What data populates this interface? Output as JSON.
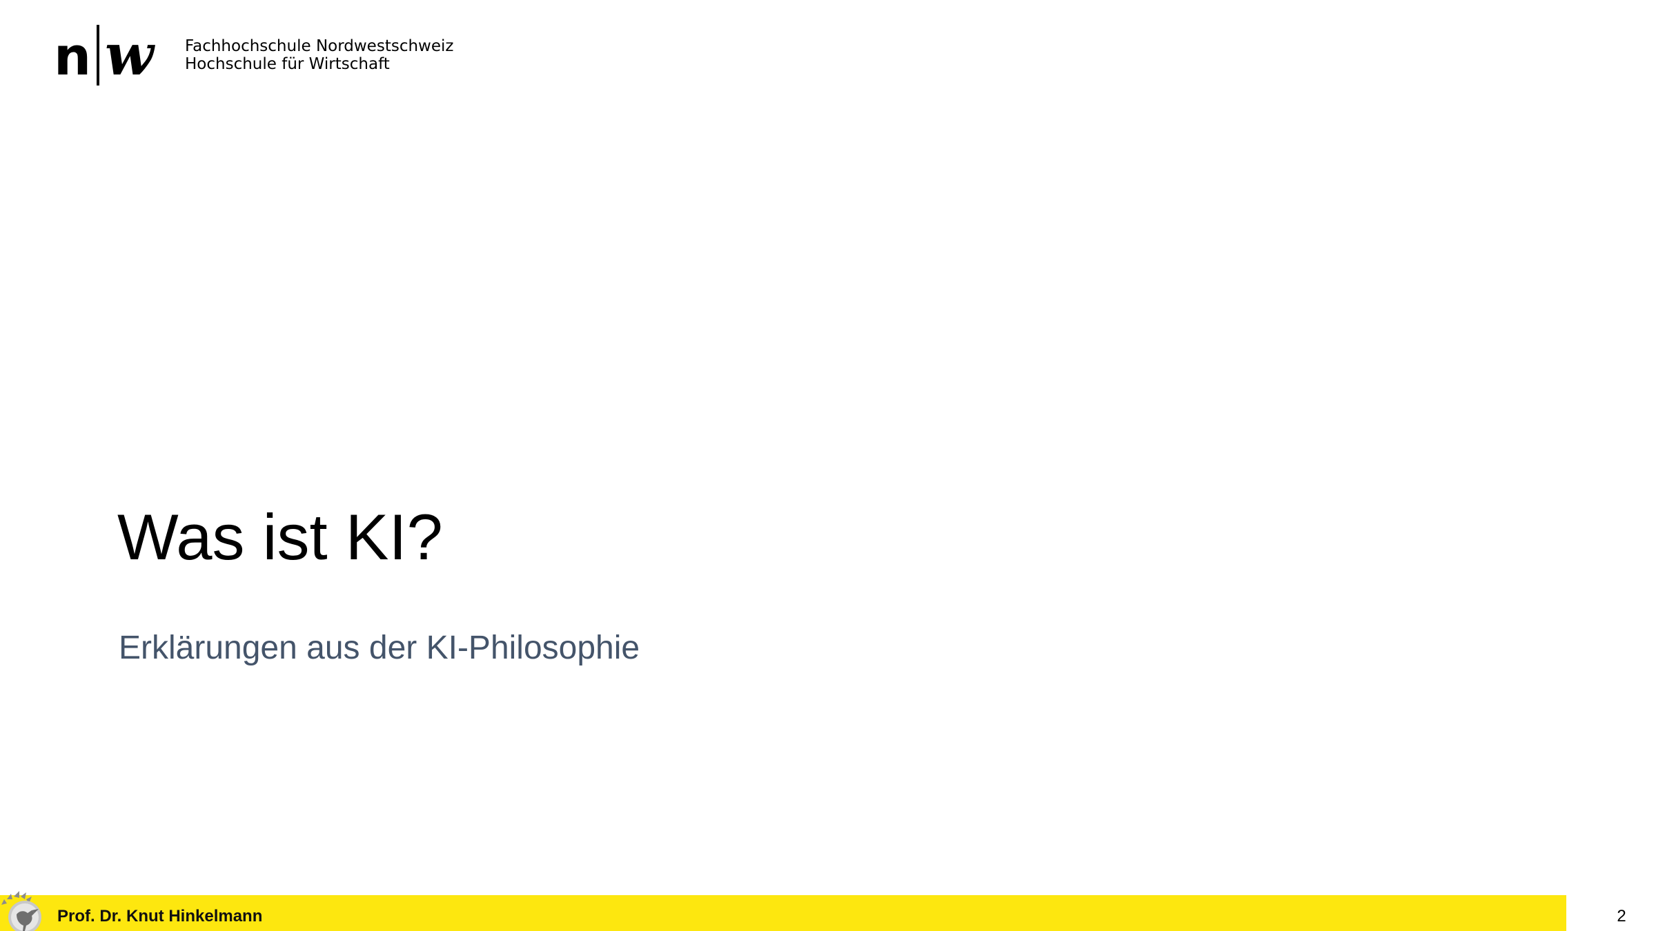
{
  "header": {
    "logo_line1": "Fachhochschule Nordwestschweiz",
    "logo_line2": "Hochschule für Wirtschaft"
  },
  "slide": {
    "title": "Was ist KI?",
    "subtitle": "Erklärungen aus der KI-Philosophie"
  },
  "footer": {
    "author": "Prof. Dr. Knut Hinkelmann",
    "page_number": "2",
    "bar_color": "#fde70f"
  },
  "icons": {
    "brand_logo": "fhnw-logo-icon",
    "footer_logo": "rooster-logo-icon"
  }
}
